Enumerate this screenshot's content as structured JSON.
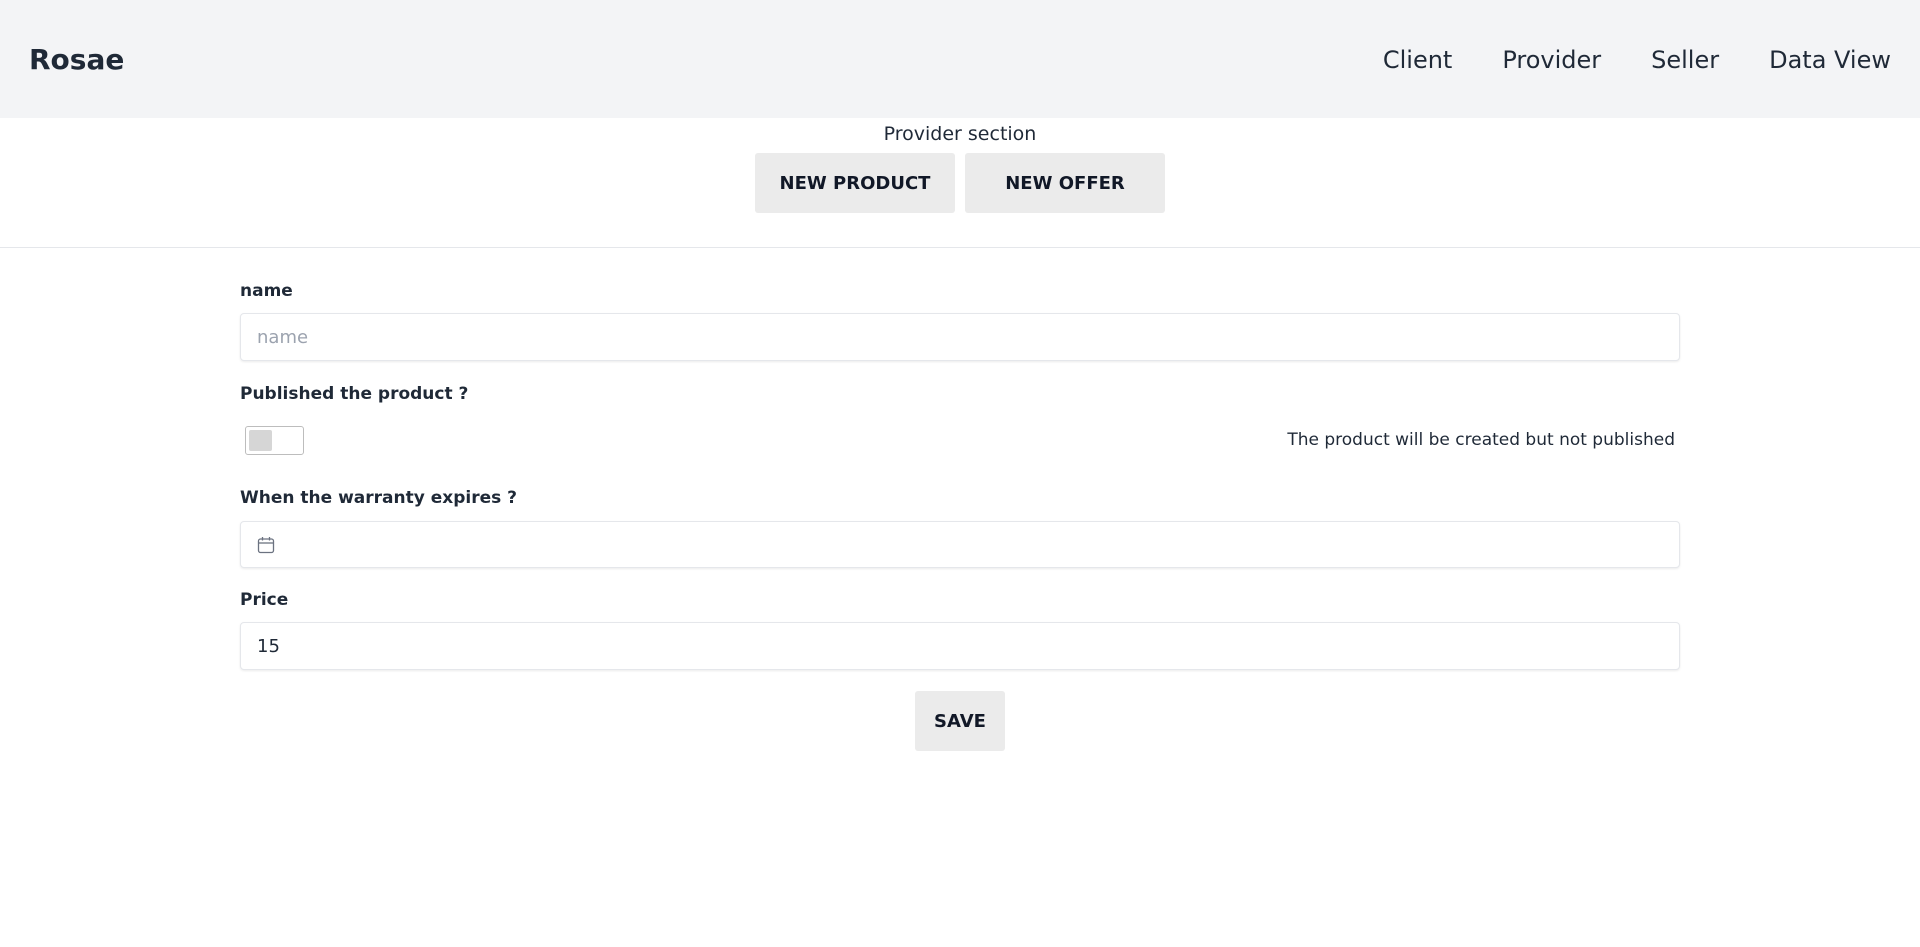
{
  "navbar": {
    "brand": "Rosae",
    "links": [
      "Client",
      "Provider",
      "Seller",
      "Data View"
    ]
  },
  "section": {
    "title": "Provider section",
    "buttons": [
      "NEW PRODUCT",
      "NEW OFFER"
    ]
  },
  "form": {
    "name": {
      "label": "name",
      "placeholder": "name",
      "value": ""
    },
    "published": {
      "label": "Published the product ?",
      "checked": false,
      "hint": "The product will be created but not published"
    },
    "warranty": {
      "label": "When the warranty expires ?",
      "icon": "calendar-icon",
      "value": ""
    },
    "price": {
      "label": "Price",
      "value": "15"
    },
    "save_label": "SAVE"
  },
  "colors": {
    "navbar_bg": "#f3f4f6",
    "button_bg": "#ebebeb",
    "text": "#1f2937"
  }
}
